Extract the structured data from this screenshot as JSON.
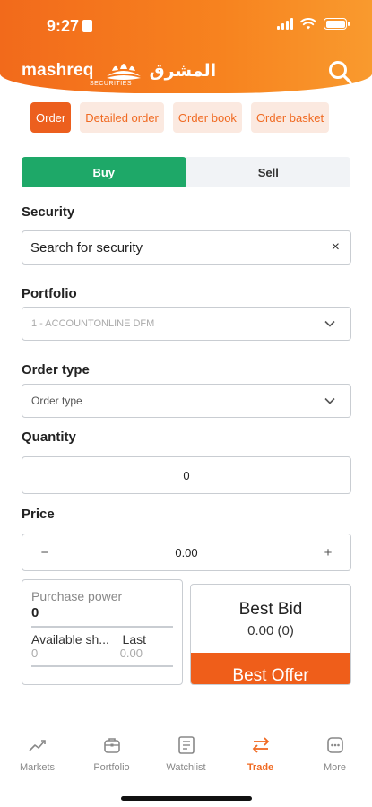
{
  "status": {
    "time": "9:27"
  },
  "brand": {
    "name": "mashreq",
    "arabic": "المشرق",
    "sub": "SECURITIES"
  },
  "tabs": [
    {
      "label": "Order",
      "active": true
    },
    {
      "label": "Detailed order",
      "active": false
    },
    {
      "label": "Order book",
      "active": false
    },
    {
      "label": "Order basket",
      "active": false
    }
  ],
  "side": {
    "buy": "Buy",
    "sell": "Sell",
    "selected": "Buy"
  },
  "security": {
    "label": "Security",
    "value": "Search for security",
    "clear": "×"
  },
  "portfolio": {
    "label": "Portfolio",
    "value": "1 - ACCOUNTONLINE DFM"
  },
  "order_type": {
    "label": "Order type",
    "value": "Order type"
  },
  "quantity": {
    "label": "Quantity",
    "value": "0"
  },
  "price": {
    "label": "Price",
    "value": "0.00",
    "minus": "−",
    "plus": "+"
  },
  "purchase": {
    "label": "Purchase power",
    "value": "0",
    "available_label": "Available sh...",
    "last_label": "Last",
    "available_value": "0",
    "last_value": "0.00"
  },
  "best_bid": {
    "title": "Best Bid",
    "value": "0.00 (0)"
  },
  "best_offer": {
    "title": "Best Offer"
  },
  "nav": [
    {
      "label": "Markets",
      "icon": "chart-icon"
    },
    {
      "label": "Portfolio",
      "icon": "briefcase-icon"
    },
    {
      "label": "Watchlist",
      "icon": "watchlist-icon"
    },
    {
      "label": "Trade",
      "icon": "transfer-icon",
      "active": true
    },
    {
      "label": "More",
      "icon": "more-icon"
    }
  ],
  "colors": {
    "accent": "#f06a22",
    "buy": "#1ea868",
    "offer": "#ef5e1a"
  }
}
